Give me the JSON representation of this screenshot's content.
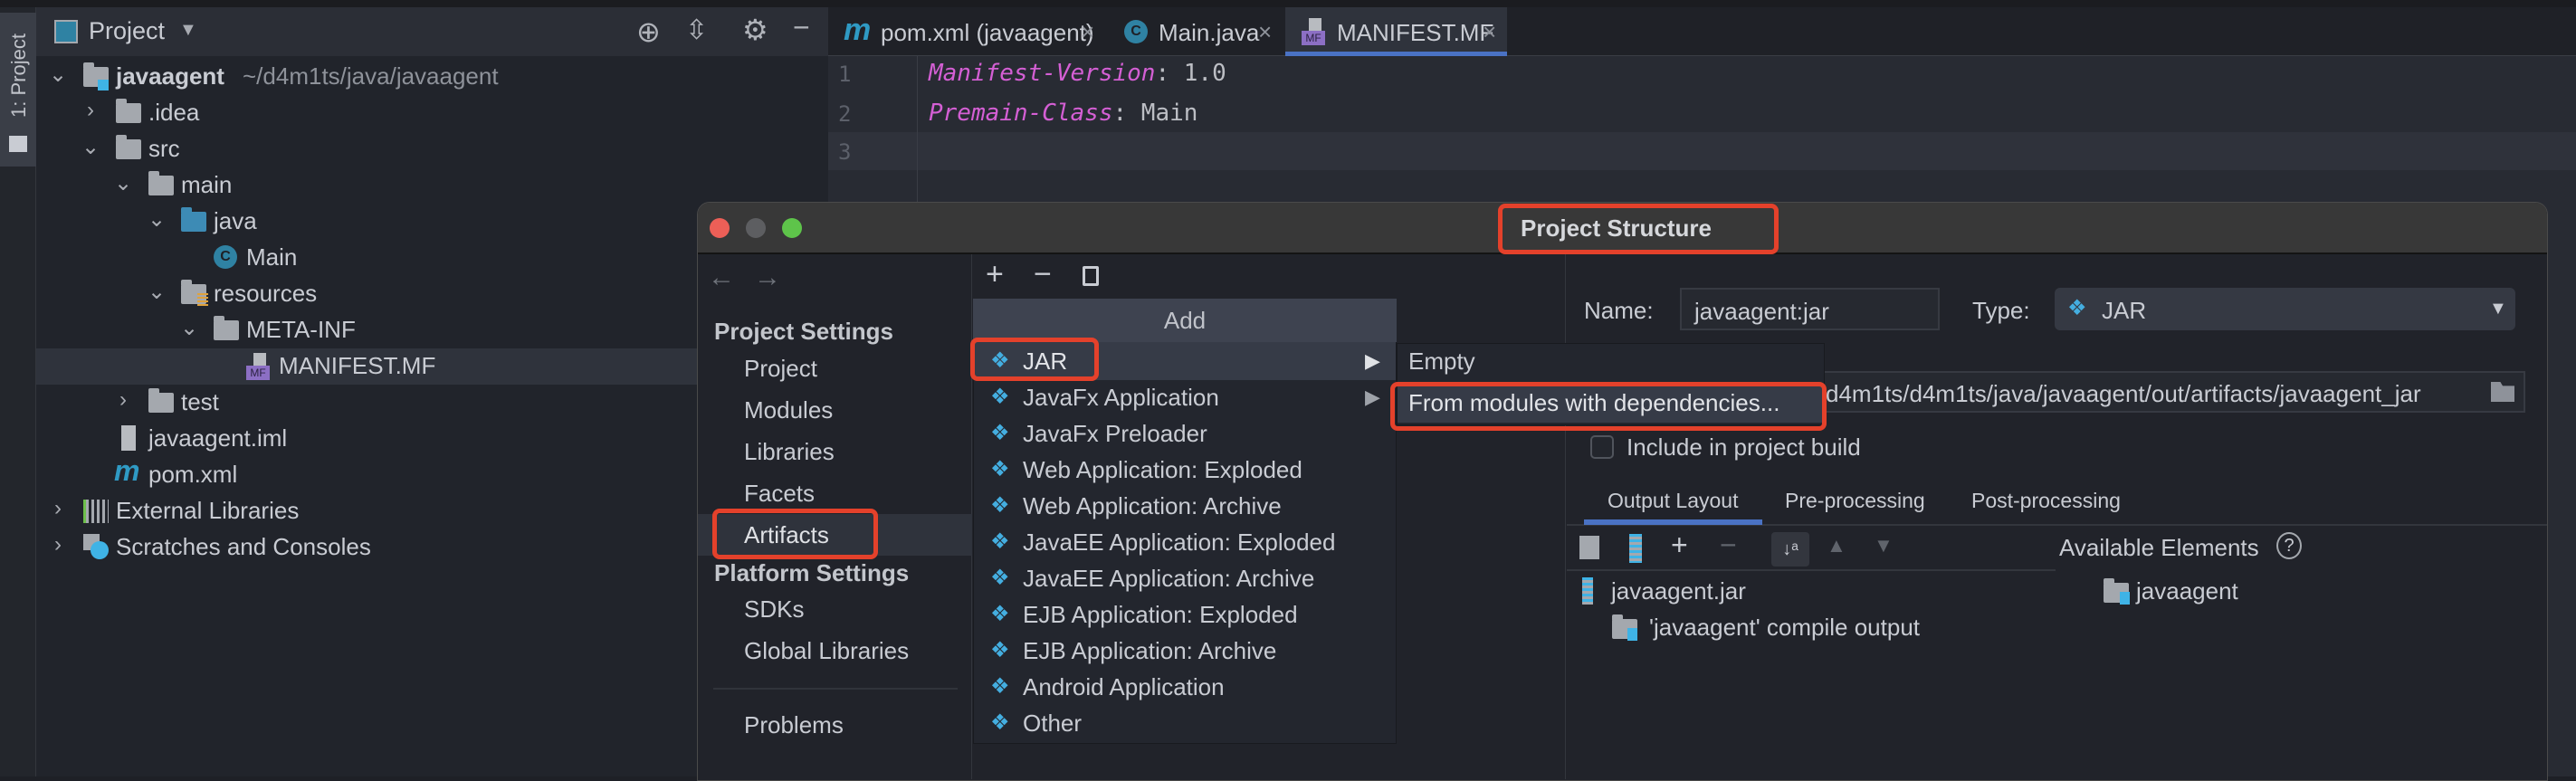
{
  "left_strip": {
    "label": "1: Project"
  },
  "project_panel": {
    "title": "Project",
    "tree": [
      {
        "label": "javaagent",
        "path": "~/d4m1ts/java/javaagent"
      },
      {
        "label": ".idea"
      },
      {
        "label": "src"
      },
      {
        "label": "main"
      },
      {
        "label": "java"
      },
      {
        "label": "Main"
      },
      {
        "label": "resources"
      },
      {
        "label": "META-INF"
      },
      {
        "label": "MANIFEST.MF",
        "icon_text": "MF"
      },
      {
        "label": "test"
      },
      {
        "label": "javaagent.iml"
      },
      {
        "label": "pom.xml"
      },
      {
        "label": "External Libraries"
      },
      {
        "label": "Scratches and Consoles"
      }
    ]
  },
  "editor": {
    "tabs": [
      {
        "label": "pom.xml (javaagent)",
        "icon": "m"
      },
      {
        "label": "Main.java",
        "icon": "C"
      },
      {
        "label": "MANIFEST.MF",
        "icon": "MF",
        "active": true
      }
    ],
    "line_numbers": [
      "1",
      "2",
      "3"
    ],
    "lines": [
      {
        "key": "Manifest-Version",
        "sep": ":",
        "value": " 1.0"
      },
      {
        "key": "Premain-Class",
        "sep": ":",
        "value": " Main"
      }
    ]
  },
  "dialog": {
    "title": "Project Structure",
    "nav": {
      "project_settings": "Project Settings",
      "items": [
        "Project",
        "Modules",
        "Libraries",
        "Facets",
        "Artifacts"
      ],
      "platform_settings": "Platform Settings",
      "platform_items": [
        "SDKs",
        "Global Libraries"
      ],
      "problems": "Problems"
    },
    "add_menu": {
      "header": "Add",
      "items": [
        "JAR",
        "JavaFx Application",
        "JavaFx Preloader",
        "Web Application: Exploded",
        "Web Application: Archive",
        "JavaEE Application: Exploded",
        "JavaEE Application: Archive",
        "EJB Application: Exploded",
        "EJB Application: Archive",
        "Android Application",
        "Other"
      ]
    },
    "submenu": {
      "items": [
        "Empty",
        "From modules with dependencies..."
      ]
    },
    "artifact": {
      "name_label": "Name:",
      "name_value": "javaagent:jar",
      "type_label": "Type:",
      "type_value": "JAR",
      "output_dir_value": "d4m1ts/d4m1ts/java/javaagent/out/artifacts/javaagent_jar",
      "include_label": "Include in project build",
      "include_checked": false,
      "tabs": [
        "Output Layout",
        "Pre-processing",
        "Post-processing"
      ],
      "available_elements": "Available Elements",
      "help": "?",
      "layout_tree": [
        "javaagent.jar",
        "'javaagent' compile output"
      ],
      "available_tree": [
        "javaagent"
      ]
    },
    "highlight_color": "#e4412b"
  }
}
